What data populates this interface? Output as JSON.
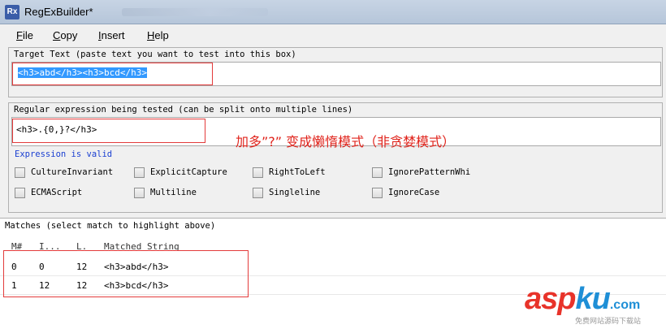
{
  "window": {
    "title": "RegExBuilder*",
    "icon": "rx-app-icon"
  },
  "menu": [
    {
      "underline": "F",
      "rest": "ile"
    },
    {
      "underline": "C",
      "rest": "opy"
    },
    {
      "underline": "I",
      "rest": "nsert"
    },
    {
      "underline": "H",
      "rest": "elp"
    }
  ],
  "target": {
    "label": "Target Text (paste text you want to test into this box)",
    "value": "<h3>abd</h3><h3>bcd</h3>"
  },
  "regex": {
    "label": "Regular expression being tested (can be split onto multiple lines)",
    "value": "<h3>.{0,}?</h3>",
    "status": "Expression is valid"
  },
  "annotation": "加多”?” 变成懒惰模式（非贪婪模式）",
  "options": [
    "CultureInvariant",
    "ExplicitCapture",
    "RightToLeft",
    "IgnorePatternWhi",
    "ECMAScript",
    "Multiline",
    "Singleline",
    "IgnoreCase"
  ],
  "matches": {
    "label": "Matches (select match to highlight above)",
    "columns": [
      "M#",
      "I...",
      "L.",
      "Matched String"
    ],
    "rows": [
      {
        "m": "0",
        "i": "0",
        "l": "12",
        "s": "<h3>abd</h3>"
      },
      {
        "m": "1",
        "i": "12",
        "l": "12",
        "s": "<h3>bcd</h3>"
      }
    ]
  },
  "watermark": {
    "main_a": "asp",
    "main_k": "ku",
    "dot_com": ".com",
    "sub": "免费网站源码下载站"
  },
  "colors": {
    "annotation": "#e0241c",
    "valid": "#1a3fd1",
    "highlight_box": "#e33b3b",
    "selection": "#3399ff"
  }
}
